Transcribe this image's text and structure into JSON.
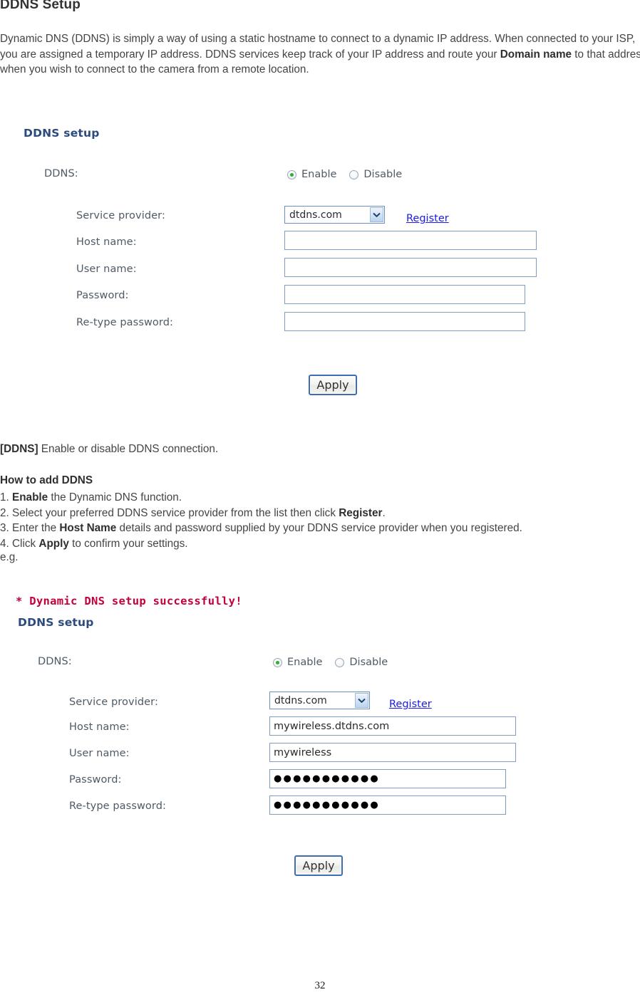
{
  "document": {
    "title": "DDNS Setup",
    "intro_parts": [
      {
        "text": "Dynamic DNS (DDNS) is simply a way of using a static hostname to connect to a dynamic IP address. When connected to your ISP, you are assigned a temporary IP address. DDNS services keep track of your IP address and route your ",
        "bold": false
      },
      {
        "text": "Domain name",
        "bold": true
      },
      {
        "text": " to that address when you wish to connect to the camera from a remote location.",
        "bold": false
      }
    ],
    "note_parts": [
      {
        "text": "[DDNS]",
        "bold": true
      },
      {
        "text": " Enable or disable DDNS connection.",
        "bold": false
      }
    ],
    "howto_title": "How to add DDNS",
    "steps": [
      [
        {
          "text": "1. ",
          "bold": false
        },
        {
          "text": "Enable",
          "bold": true
        },
        {
          "text": " the Dynamic DNS function.",
          "bold": false
        }
      ],
      [
        {
          "text": "2. Select your preferred DDNS service provider from the list then click ",
          "bold": false
        },
        {
          "text": "Register",
          "bold": true
        },
        {
          "text": ".",
          "bold": false
        }
      ],
      [
        {
          "text": "3. Enter the ",
          "bold": false
        },
        {
          "text": "Host Name",
          "bold": true
        },
        {
          "text": " details and password supplied by your DDNS service provider when you registered.",
          "bold": false
        }
      ],
      [
        {
          "text": "4. Click ",
          "bold": false
        },
        {
          "text": "Apply",
          "bold": true
        },
        {
          "text": " to confirm your settings.",
          "bold": false
        }
      ]
    ],
    "eg_label": "e.g.",
    "page_number": "32"
  },
  "form_empty": {
    "heading": "DDNS setup",
    "ddns_label": "DDNS:",
    "radio_enable_label": "Enable",
    "radio_disable_label": "Disable",
    "radio_selected": "Enable",
    "service_provider_label": "Service provider:",
    "service_provider_value": "dtdns.com",
    "register_label": "Register",
    "host_name_label": "Host name:",
    "host_name_value": "",
    "user_name_label": "User name:",
    "user_name_value": "",
    "password_label": "Password:",
    "password_value": "",
    "retype_password_label": "Re-type password:",
    "retype_password_value": "",
    "apply_label": "Apply"
  },
  "form_filled": {
    "success_message": "* Dynamic DNS setup successfully!",
    "heading": "DDNS setup",
    "ddns_label": "DDNS:",
    "radio_enable_label": "Enable",
    "radio_disable_label": "Disable",
    "radio_selected": "Enable",
    "service_provider_label": "Service provider:",
    "service_provider_value": "dtdns.com",
    "register_label": "Register",
    "host_name_label": "Host name:",
    "host_name_value": "mywireless.dtdns.com",
    "user_name_label": "User name:",
    "user_name_value": "mywireless",
    "password_label": "Password:",
    "password_value": "●●●●●●●●●●●",
    "retype_password_label": "Re-type password:",
    "retype_password_value": "●●●●●●●●●●●",
    "apply_label": "Apply"
  },
  "colors": {
    "heading_blue": "#2b4a7e",
    "success_red": "#c2003c",
    "link_blue": "#1a1aee",
    "input_border": "#7e9dc4",
    "radio_dot_green": "#2fae2f",
    "apply_border": "#3c6eb4"
  }
}
